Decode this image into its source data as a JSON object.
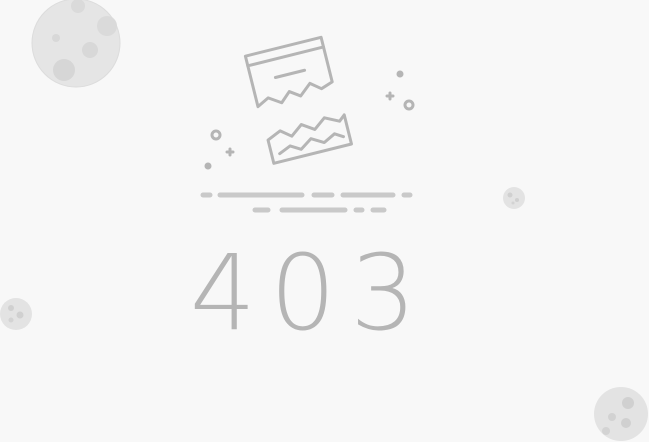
{
  "error": {
    "code": "403"
  },
  "colors": {
    "background": "#f8f8f8",
    "ink": "#b5b5b5",
    "planet": "#e2e2e2",
    "crater": "#d0d0d0"
  },
  "icons": {
    "illustration": "broken-browser-window-icon",
    "decor": "moon-icon"
  }
}
